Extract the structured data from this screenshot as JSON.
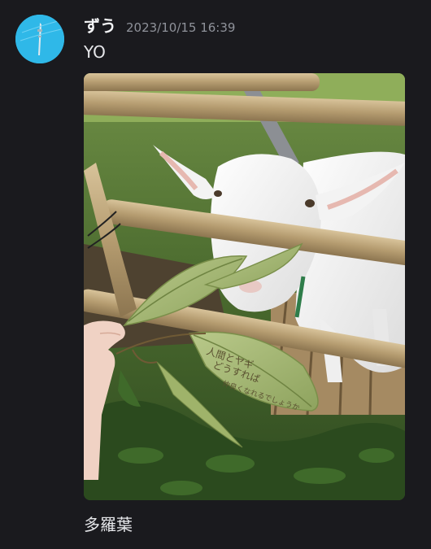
{
  "message": {
    "author": "ずう",
    "timestamp": "2023/10/15 16:39",
    "text_first": "YO",
    "text_second": "多羅葉",
    "avatar": {
      "icon": "avatar-icon",
      "background_color": "#2fb8e8"
    },
    "attachment": {
      "kind": "photo",
      "subject": "goat-eating-leaf-photo",
      "leaf_writing": [
        "人間とヤギ",
        "どうすれば",
        "仲良くなれるでしょうか"
      ]
    }
  },
  "colors": {
    "background": "#1a1a1e",
    "username": "#f2f3f5",
    "timestamp": "#8f929a",
    "message_text": "#e6e7ea"
  }
}
